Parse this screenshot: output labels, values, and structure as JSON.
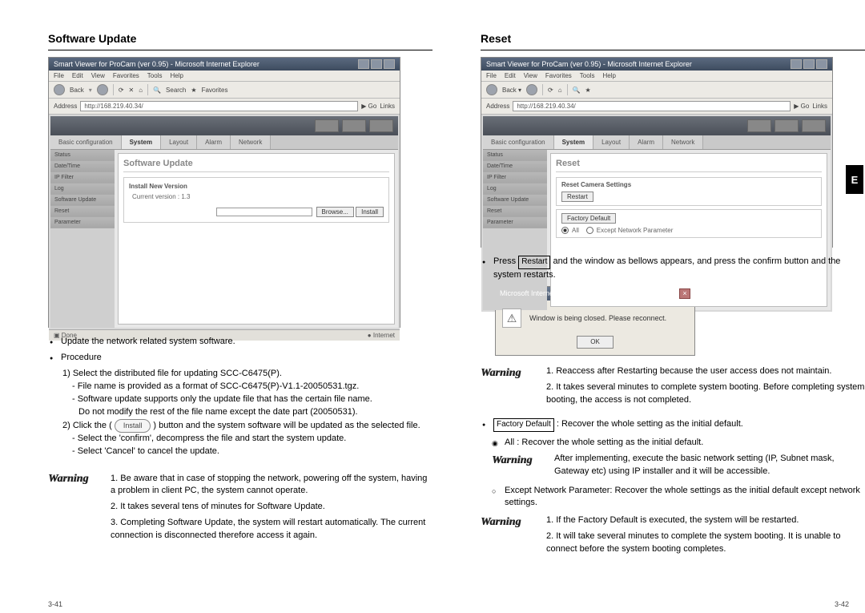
{
  "side_tab": "E",
  "page_numbers": {
    "left": "3-41",
    "right": "3-42"
  },
  "left": {
    "heading": "Software Update",
    "browser": {
      "title": "Smart Viewer for ProCam (ver 0.95) - Microsoft Internet Explorer",
      "menu": [
        "File",
        "Edit",
        "View",
        "Favorites",
        "Tools",
        "Help"
      ],
      "toolbar": {
        "back": "Back",
        "search": "Search",
        "favorites": "Favorites"
      },
      "address_label": "Address",
      "address_value": "http://168.219.40.34/",
      "go": "Go",
      "links": "Links",
      "tabs": [
        "Basic configuration",
        "System",
        "Layout",
        "Alarm",
        "Network"
      ],
      "active_tab": 1,
      "sidebar": [
        "Status",
        "Date/Time",
        "IP Filter",
        "Log",
        "Software Update",
        "Reset",
        "Parameter"
      ],
      "pane_title": "Software Update",
      "install_fieldset_title": "Install New Version",
      "current_version": "Current version : 1.3",
      "browse_btn": "Browse...",
      "install_btn": "Install",
      "status_left": "Done",
      "status_right": "Internet"
    },
    "body": {
      "bullet1": "Update the network related system software.",
      "bullet2": "Procedure",
      "step1": "1) Select the distributed file for updating SCC-C6475(P).",
      "step1a": "- File name is provided as a format of SCC-C6475(P)-V1.1-20050531.tgz.",
      "step1b_1": "- Software update supports only the update file that has the certain file name.",
      "step1b_2": "Do not modify the rest of the file name except the date part (20050531).",
      "step2_pre": "2) Click the (",
      "step2_btn": "Install",
      "step2_post": ") button and the system software will be updated as the selected file.",
      "step2a": "- Select the 'confirm', decompress the file and start the system update.",
      "step2b": "- Select 'Cancel' to cancel the update."
    },
    "warning": {
      "label": "Warning",
      "l1": "1. Be aware that in case of stopping the network, powering off the system, having a problem in client PC, the system cannot operate.",
      "l2": "2. It takes several tens of minutes for Software Update.",
      "l3": "3. Completing Software Update, the system will restart automatically. The current connection is disconnected therefore access it again."
    }
  },
  "right": {
    "heading": "Reset",
    "browser": {
      "title": "Smart Viewer for ProCam (ver 0.95) - Microsoft Internet Explorer",
      "menu": [
        "File",
        "Edit",
        "View",
        "Favorites",
        "Tools",
        "Help"
      ],
      "address_label": "Address",
      "address_value": "http://168.219.40.34/",
      "go": "Go",
      "links": "Links",
      "tabs": [
        "Basic configuration",
        "System",
        "Layout",
        "Alarm",
        "Network"
      ],
      "active_tab": 1,
      "sidebar": [
        "Status",
        "Date/Time",
        "IP Filter",
        "Log",
        "Software Update",
        "Reset",
        "Parameter"
      ],
      "pane_title": "Reset",
      "reset_fieldset_title": "Reset Camera Settings",
      "restart_btn": "Restart",
      "factory_btn": "Factory Default",
      "radio_all": "All",
      "radio_except": "Except Network Parameter"
    },
    "body": {
      "press_pre": "Press ",
      "restart_box": "Restart",
      "press_post": " and the window as bellows appears, and press the confirm button and the system restarts."
    },
    "dialog": {
      "title": "Microsoft Internet Explorer",
      "msg": "Window is being closed. Please reconnect.",
      "ok": "OK"
    },
    "warning1": {
      "label": "Warning",
      "l1": "1. Reaccess after Restarting because the user access does not maintain.",
      "l2": "2. It takes several minutes to complete system booting. Before completing system booting, the access is not completed."
    },
    "factory": {
      "box": "Factory Default",
      "post": " : Recover the whole setting as the initial default.",
      "all_line": "All : Recover the whole setting as the initial default."
    },
    "warning2": {
      "label": "Warning",
      "text": "After implementing, execute the basic network setting (IP, Subnet mask, Gateway etc) using IP installer and it will be accessible."
    },
    "except_line": "Except Network Parameter: Recover the whole settings as the initial default except network settings.",
    "warning3": {
      "label": "Warning",
      "l1": "1. If the Factory Default is executed, the system will be restarted.",
      "l2": "2. It will take several minutes to complete the system booting. It is unable to connect before the system booting completes."
    }
  }
}
